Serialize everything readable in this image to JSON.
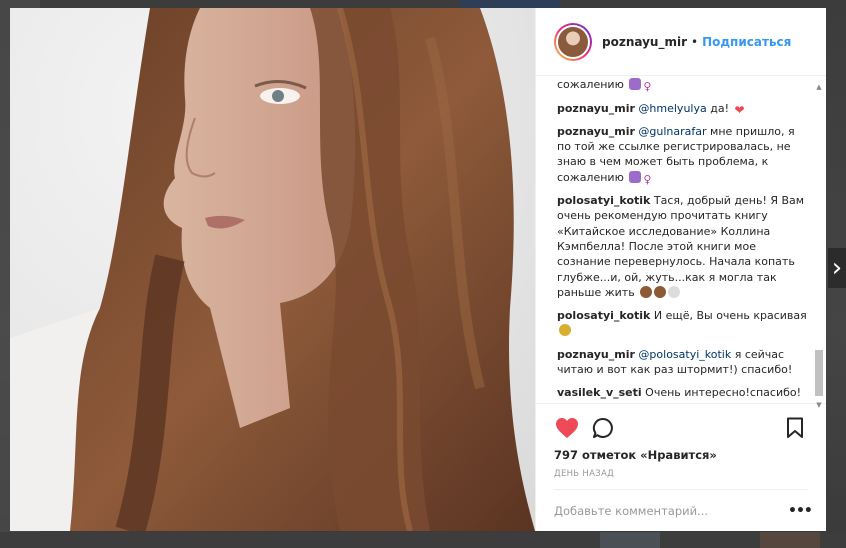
{
  "post": {
    "username": "poznayu_mir",
    "follow_label": "Подписаться",
    "separator": "•",
    "likes_text": "797 отметок «Нравится»",
    "date_text": "день назад",
    "comment_placeholder": "Добавьте комментарий...",
    "more_label": "•••"
  },
  "comments": [
    {
      "user": "",
      "mention": "",
      "text": "знаю в чем может быть проблема, к сожалению",
      "emoji": [
        "shrug-emoji",
        "female-sign-emoji"
      ]
    },
    {
      "user": "poznayu_mir",
      "mention": "@hmelyulya",
      "text": "да!",
      "emoji": [
        "heart-emoji"
      ]
    },
    {
      "user": "poznayu_mir",
      "mention": "@gulnarafar",
      "text": "мне пришло, я по той же ссылке регистрировалась, не знаю в чем может быть проблема, к сожалению",
      "emoji": [
        "shrug-emoji",
        "female-sign-emoji"
      ]
    },
    {
      "user": "polosatyi_kotik",
      "mention": "",
      "text": "Тася, добрый день! Я Вам очень рекомендую прочитать книгу «Китайское исследование» Коллина Кэмпбелла! После этой книги мое сознание перевернулось. Начала копать глубже...и, ой, жуть...как я могла так раньше жить",
      "emoji": [
        "see-no-evil-monkey-emoji",
        "see-no-evil-monkey-emoji",
        "skull-emoji"
      ]
    },
    {
      "user": "polosatyi_kotik",
      "mention": "",
      "text": "И ещё, Вы очень красивая",
      "emoji": [
        "bouquet-emoji"
      ]
    },
    {
      "user": "poznayu_mir",
      "mention": "@polosatyi_kotik",
      "text": "я сейчас читаю и вот как раз штормит!) спасибо!",
      "emoji": []
    },
    {
      "user": "vasilek_v_seti",
      "mention": "",
      "text": "Очень интересно!спасибо!",
      "emoji": []
    }
  ],
  "colors": {
    "follow_blue": "#3897f0",
    "heart_red": "#ed4956",
    "mention_blue": "#003569"
  },
  "icons": {
    "like": "heart-icon",
    "comment": "comment-bubble-icon",
    "save": "bookmark-icon",
    "next": "chevron-right-icon"
  },
  "state": {
    "liked": true
  }
}
